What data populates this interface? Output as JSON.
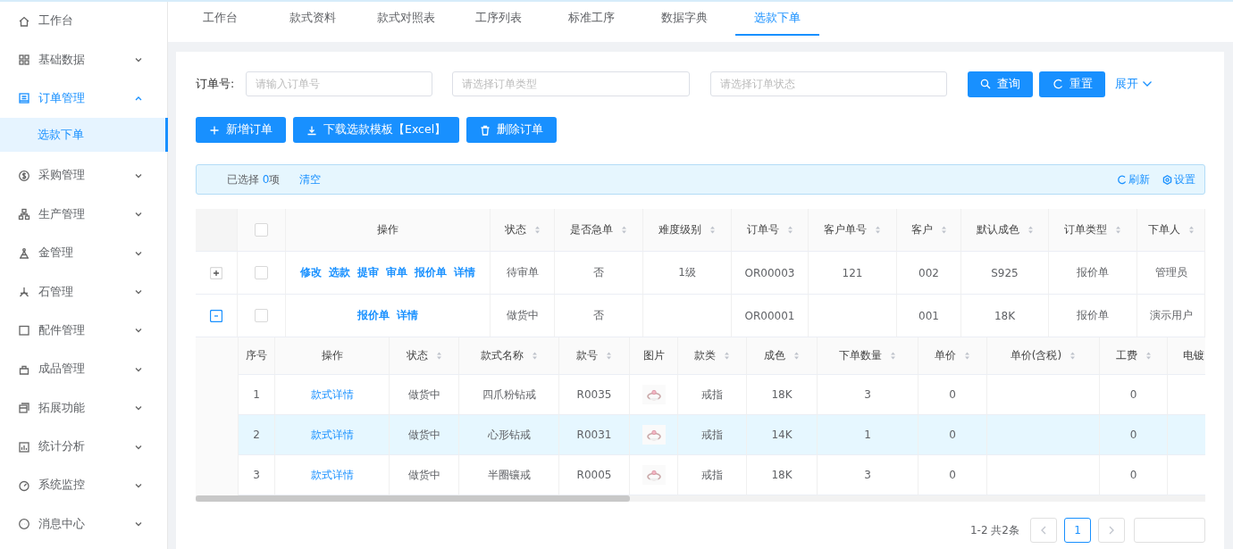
{
  "sidebar": {
    "items": [
      {
        "label": "工作台",
        "kind": "link",
        "selected": false
      },
      {
        "label": "基础数据",
        "kind": "menu",
        "expanded": false,
        "selected": false
      },
      {
        "label": "订单管理",
        "kind": "menu",
        "expanded": true,
        "selected": true,
        "children": [
          {
            "label": "选款下单",
            "selected": true
          }
        ]
      },
      {
        "label": "采购管理",
        "kind": "menu",
        "expanded": false,
        "selected": false
      },
      {
        "label": "生产管理",
        "kind": "menu",
        "expanded": false,
        "selected": false
      },
      {
        "label": "金管理",
        "kind": "menu",
        "expanded": false,
        "selected": false
      },
      {
        "label": "石管理",
        "kind": "menu",
        "expanded": false,
        "selected": false
      },
      {
        "label": "配件管理",
        "kind": "menu",
        "expanded": false,
        "selected": false
      },
      {
        "label": "成品管理",
        "kind": "menu",
        "expanded": false,
        "selected": false
      },
      {
        "label": "拓展功能",
        "kind": "menu",
        "expanded": false,
        "selected": false
      },
      {
        "label": "统计分析",
        "kind": "menu",
        "expanded": false,
        "selected": false
      },
      {
        "label": "系统监控",
        "kind": "menu",
        "expanded": false,
        "selected": false
      },
      {
        "label": "消息中心",
        "kind": "menu",
        "expanded": false,
        "selected": false
      }
    ]
  },
  "tabs": [
    {
      "label": "工作台",
      "selected": false
    },
    {
      "label": "款式资料",
      "selected": false
    },
    {
      "label": "款式对照表",
      "selected": false
    },
    {
      "label": "工序列表",
      "selected": false
    },
    {
      "label": "标准工序",
      "selected": false
    },
    {
      "label": "数据字典",
      "selected": false
    },
    {
      "label": "选款下单",
      "selected": true
    }
  ],
  "search": {
    "order_no_label": "订单号:",
    "order_no_placeholder": "请输入订单号",
    "order_type_placeholder": "请选择订单类型",
    "order_status_placeholder": "请选择订单状态",
    "query_button": "查询",
    "reset_button": "重置",
    "expand_link": "展开"
  },
  "actions": [
    {
      "label": "新增订单",
      "kind": "add"
    },
    {
      "label": "下载选款模板【Excel】",
      "kind": "download"
    },
    {
      "label": "删除订单",
      "kind": "delete"
    }
  ],
  "alert": {
    "prefix": "已选择 ",
    "count": "0",
    "suffix": "项",
    "clear_link": "清空",
    "refresh_link": "刷新",
    "settings_link": "设置"
  },
  "table": {
    "header_checked": false,
    "columns": [
      {
        "label": "操作",
        "kind": "actions",
        "sortable": false
      },
      {
        "label": "状态",
        "kind": "text",
        "sortable": true
      },
      {
        "label": "是否急单",
        "kind": "text",
        "sortable": true
      },
      {
        "label": "难度级别",
        "kind": "text",
        "sortable": true
      },
      {
        "label": "订单号",
        "kind": "text",
        "sortable": true
      },
      {
        "label": "客户单号",
        "kind": "text",
        "sortable": true
      },
      {
        "label": "客户",
        "kind": "text",
        "sortable": true
      },
      {
        "label": "默认成色",
        "kind": "text",
        "sortable": true
      },
      {
        "label": "订单类型",
        "kind": "text",
        "sortable": true
      },
      {
        "label": "下单人",
        "kind": "text",
        "sortable": true
      }
    ],
    "rows": [
      {
        "expanded": false,
        "checked": false,
        "cells": [
          [
            "修改",
            "选款",
            "提审",
            "审单",
            "报价单",
            "详情"
          ],
          "待审单",
          "否",
          "1级",
          "OR00003",
          "121",
          "002",
          "S925",
          "报价单",
          "管理员"
        ]
      },
      {
        "expanded": true,
        "checked": false,
        "cells": [
          [
            "报价单",
            "详情"
          ],
          "做货中",
          "否",
          null,
          "OR00001",
          null,
          "001",
          "18K",
          "报价单",
          "演示用户"
        ],
        "detail": {
          "columns": [
            {
              "label": "序号",
              "kind": "index",
              "sortable": false
            },
            {
              "label": "操作",
              "kind": "link",
              "sortable": false
            },
            {
              "label": "状态",
              "kind": "text",
              "sortable": true
            },
            {
              "label": "款式名称",
              "kind": "text",
              "sortable": true
            },
            {
              "label": "款号",
              "kind": "text",
              "sortable": true
            },
            {
              "label": "图片",
              "kind": "picture",
              "sortable": false
            },
            {
              "label": "款类",
              "kind": "text",
              "sortable": true
            },
            {
              "label": "成色",
              "kind": "text",
              "sortable": true
            },
            {
              "label": "下单数量",
              "kind": "text",
              "sortable": true
            },
            {
              "label": "单价",
              "kind": "text",
              "sortable": true
            },
            {
              "label": "单价(含税)",
              "kind": "text",
              "sortable": true
            },
            {
              "label": "工费",
              "kind": "text",
              "sortable": true
            },
            {
              "label": "电镀",
              "kind": "text",
              "sortable": false
            }
          ],
          "rows": [
            {
              "selected": false,
              "cells": [
                "1",
                "款式详情",
                "做货中",
                "四爪粉钻戒",
                "R0035",
                {
                  "kind": "picture"
                },
                "戒指",
                "18K",
                "3",
                "0",
                null,
                "0",
                null
              ]
            },
            {
              "selected": true,
              "cells": [
                "2",
                "款式详情",
                "做货中",
                "心形钻戒",
                "R0031",
                {
                  "kind": "picture"
                },
                "戒指",
                "14K",
                "1",
                "0",
                null,
                "0",
                null
              ]
            },
            {
              "selected": false,
              "cells": [
                "3",
                "款式详情",
                "做货中",
                "半圈镶戒",
                "R0005",
                {
                  "kind": "picture"
                },
                "戒指",
                "18K",
                "3",
                "0",
                null,
                "0",
                null
              ]
            }
          ]
        }
      }
    ]
  },
  "pagination": {
    "total": "1-2 共2条",
    "pages": [
      {
        "label": "1",
        "selected": true
      }
    ]
  }
}
